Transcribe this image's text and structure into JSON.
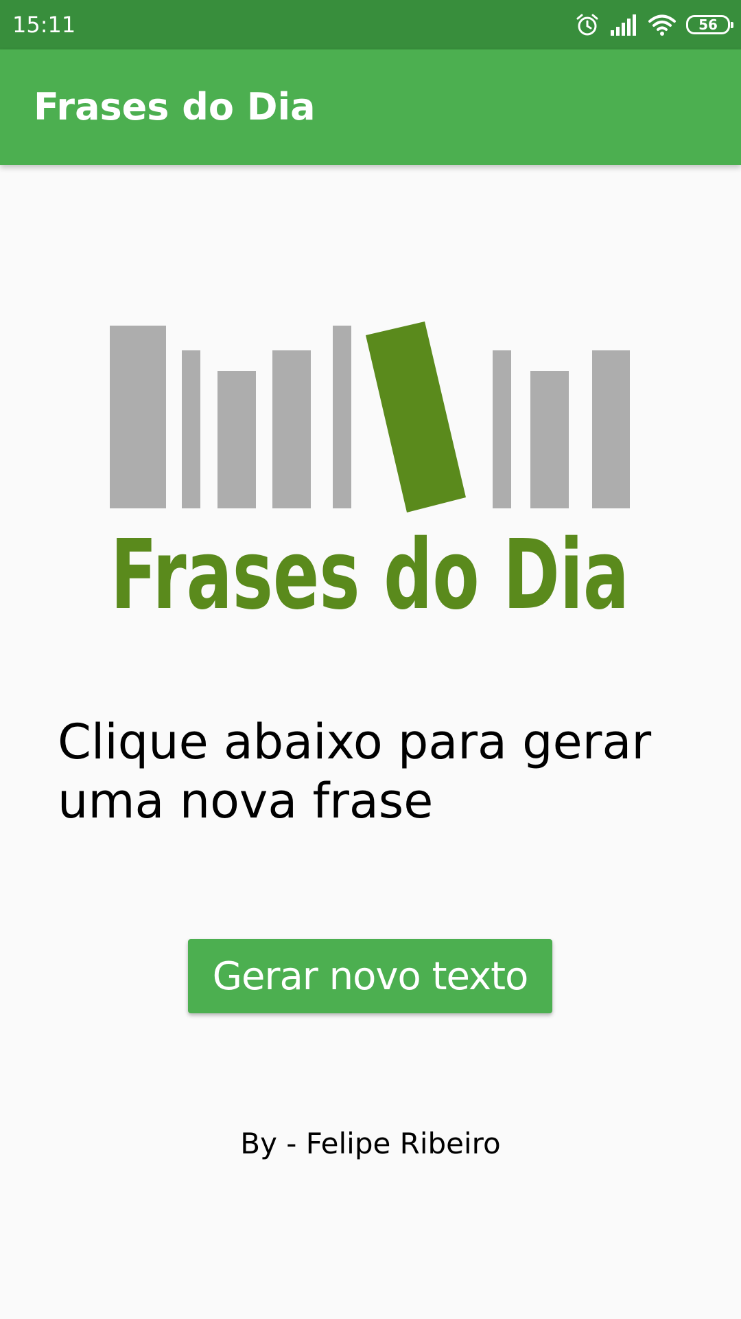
{
  "status_bar": {
    "time": "15:11",
    "battery_level": "56",
    "icons": [
      "alarm-icon",
      "signal-icon",
      "wifi-icon",
      "battery-icon"
    ]
  },
  "app_bar": {
    "title": "Frases do Dia"
  },
  "logo": {
    "text": "Frases do Dia",
    "colors": {
      "books": "#adadad",
      "accent": "#5a8a1c"
    }
  },
  "main": {
    "instruction": "Clique abaixo para gerar uma nova frase",
    "button_label": "Gerar novo texto",
    "author": "By - Felipe Ribeiro"
  },
  "colors": {
    "status_bar": "#388e3c",
    "primary": "#4caf50",
    "background": "#fafafa"
  }
}
